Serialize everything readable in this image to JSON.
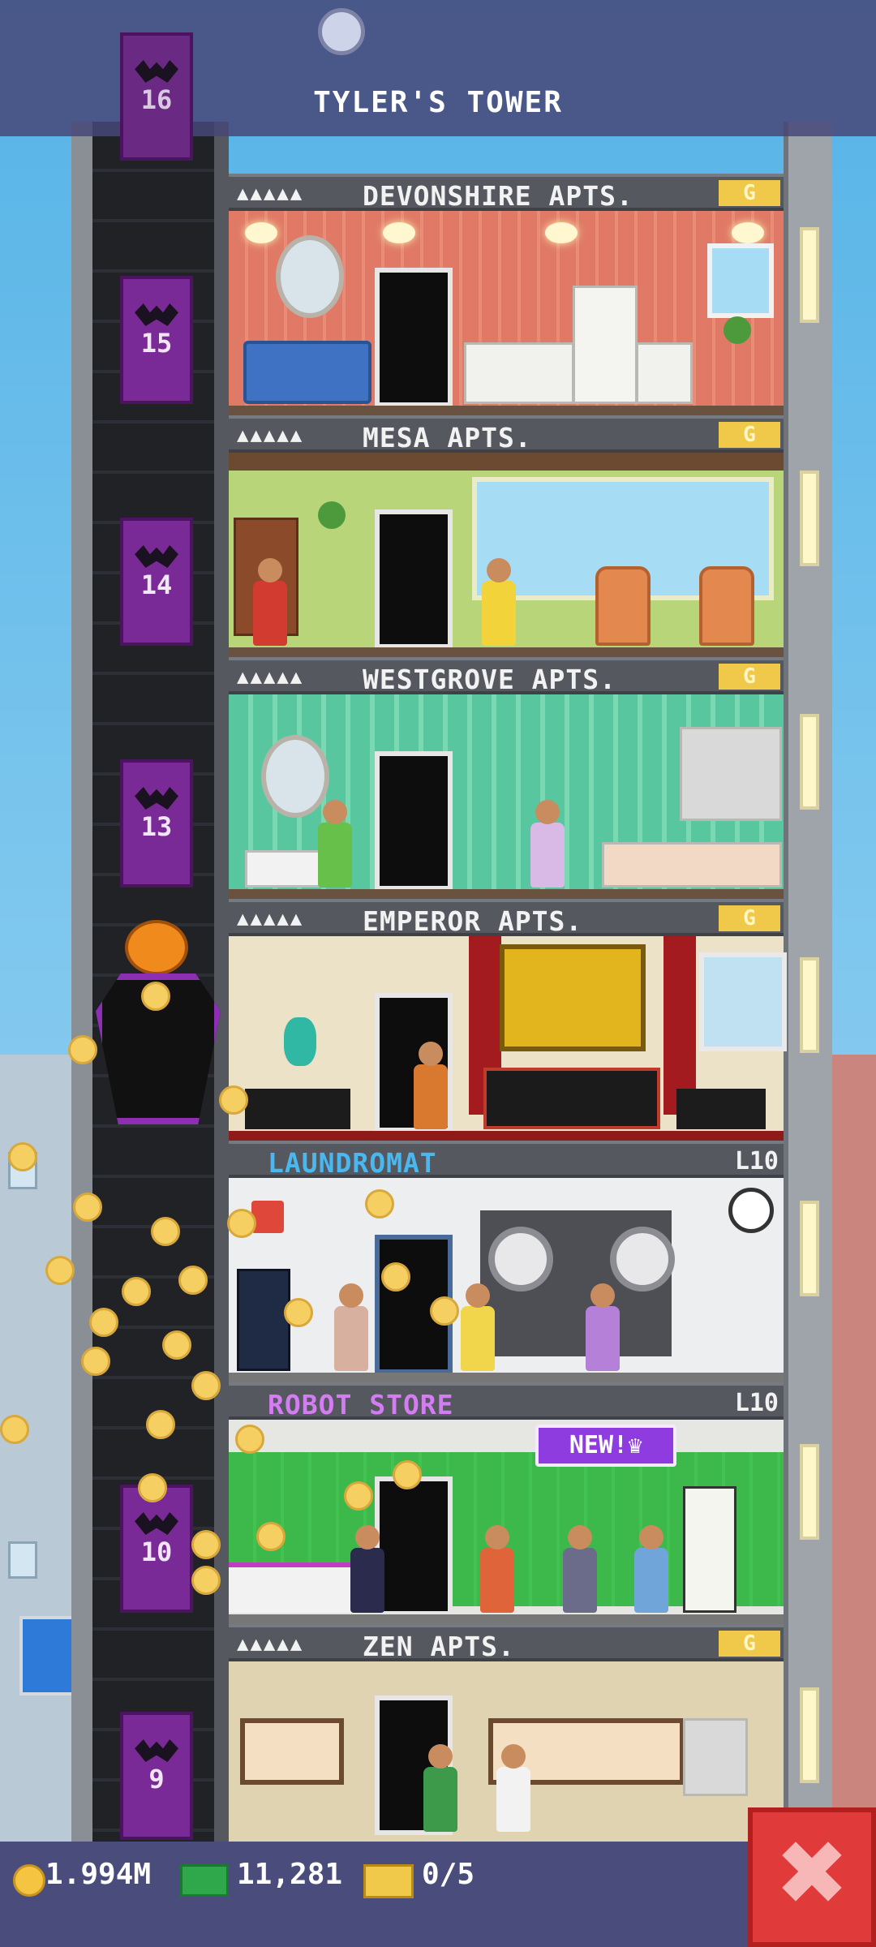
{
  "header": {
    "title": "TYLER'S TOWER"
  },
  "elevator": {
    "top_floor_number": "16",
    "cars": [
      "15",
      "14",
      "13",
      "10",
      "9"
    ]
  },
  "floors": [
    {
      "name": "DEVONSHIRE APTS.",
      "residents": "▲▲▲▲▲",
      "tag": "G",
      "type": "residential"
    },
    {
      "name": "MESA APTS.",
      "residents": "▲▲▲▲▲",
      "tag": "G",
      "type": "residential"
    },
    {
      "name": "WESTGROVE APTS.",
      "residents": "▲▲▲▲▲",
      "tag": "G",
      "type": "residential"
    },
    {
      "name": "EMPEROR APTS.",
      "residents": "▲▲▲▲▲",
      "tag": "G",
      "type": "residential"
    },
    {
      "name": "LAUNDROMAT",
      "level": "L10",
      "type": "business",
      "color": "#49b8f0"
    },
    {
      "name": "ROBOT STORE",
      "level": "L10",
      "type": "business",
      "color": "#d47cf2",
      "badge": "NEW!♛"
    },
    {
      "name": "ZEN APTS.",
      "residents": "▲▲▲▲▲",
      "tag": "G",
      "type": "residential"
    }
  ],
  "resources": {
    "coins": "1.994M",
    "bux": "11,281",
    "chests": "0/5"
  },
  "close_button": {
    "label": "✖"
  },
  "icons": [
    "coin-icon",
    "bux-icon",
    "chest-icon",
    "close-icon",
    "bat-icon",
    "pumpkin-icon",
    "clock-icon"
  ]
}
